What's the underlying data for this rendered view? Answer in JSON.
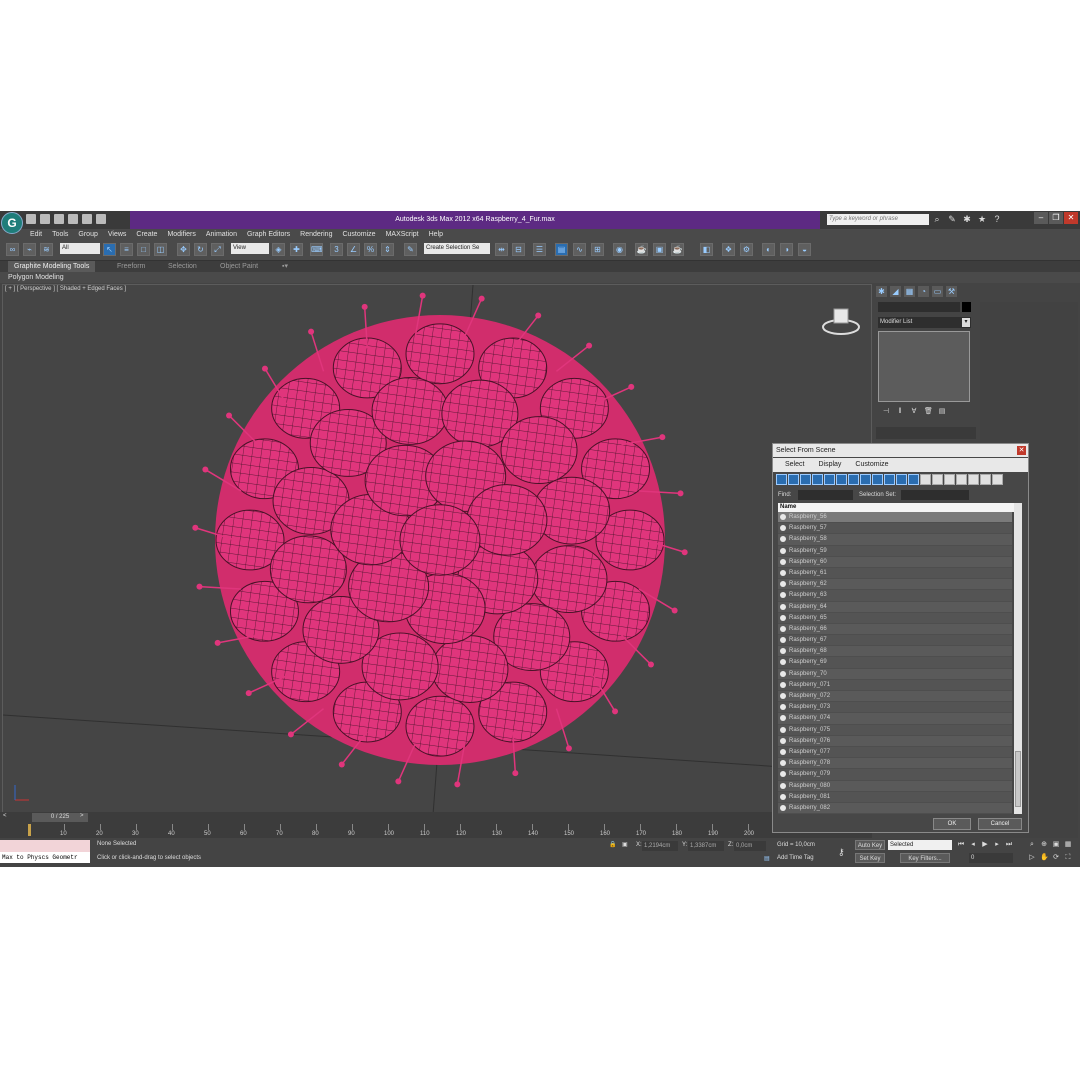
{
  "title": {
    "app_title": "Autodesk 3ds Max  2012 x64     Raspberry_4_Fur.max",
    "search_placeholder": "Type a keyword or phrase"
  },
  "menu": [
    "Edit",
    "Tools",
    "Group",
    "Views",
    "Create",
    "Modifiers",
    "Animation",
    "Graph Editors",
    "Rendering",
    "Customize",
    "MAXScript",
    "Help"
  ],
  "toolbar": {
    "selection_filter": "All",
    "ref_coord": "View",
    "named_selection": "Create Selection Se"
  },
  "ribbon": {
    "tabs": [
      "Graphite Modeling Tools",
      "Freeform",
      "Selection",
      "Object Paint"
    ],
    "panel": "Polygon Modeling"
  },
  "viewport": {
    "label": "[ + ] [ Perspective ] [ Shaded + Edged Faces ]",
    "object_color": "#e0357c"
  },
  "command_panel": {
    "modifier_list": "Modifier List"
  },
  "dialog": {
    "title": "Select From Scene",
    "menu": [
      "Select",
      "Display",
      "Customize"
    ],
    "find_label": "Find:",
    "selset_label": "Selection Set:",
    "column": "Name",
    "items": [
      "Raspberry_56",
      "Raspberry_57",
      "Raspberry_58",
      "Raspberry_59",
      "Raspberry_60",
      "Raspberry_61",
      "Raspberry_62",
      "Raspberry_63",
      "Raspberry_64",
      "Raspberry_65",
      "Raspberry_66",
      "Raspberry_67",
      "Raspberry_68",
      "Raspberry_69",
      "Raspberry_70",
      "Raspberry_071",
      "Raspberry_072",
      "Raspberry_073",
      "Raspberry_074",
      "Raspberry_075",
      "Raspberry_076",
      "Raspberry_077",
      "Raspberry_078",
      "Raspberry_079",
      "Raspberry_080",
      "Raspberry_081",
      "Raspberry_082"
    ],
    "ok": "OK",
    "cancel": "Cancel"
  },
  "timeline": {
    "frame": "0 / 225",
    "ticks": [
      "10",
      "20",
      "30",
      "40",
      "50",
      "60",
      "70",
      "80",
      "90",
      "100",
      "110",
      "120",
      "130",
      "140",
      "150",
      "160",
      "170",
      "180",
      "190",
      "200"
    ]
  },
  "status": {
    "listener": "Max to Physcs Geometr",
    "selection": "None Selected",
    "prompt": "Click or click-and-drag to select objects",
    "x_label": "X:",
    "x": "1,2194cm",
    "y_label": "Y:",
    "y": "1,3387cm",
    "z_label": "Z:",
    "z": "0,0cm",
    "grid": "Grid = 10,0cm",
    "add_time_tag": "Add Time Tag",
    "auto_key": "Auto Key",
    "set_key": "Set Key",
    "key_mode": "Selected",
    "key_filters": "Key Filters...",
    "frame_field": "0"
  }
}
